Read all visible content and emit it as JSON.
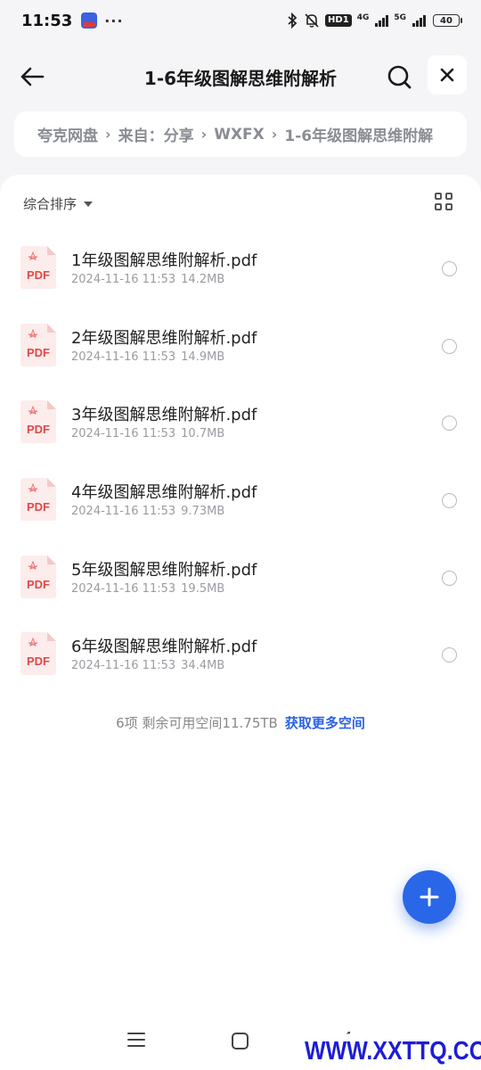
{
  "status_bar": {
    "time": "11:53",
    "dots": "···",
    "hd_label": "HD1",
    "net_4g": "4G",
    "net_5g": "5G",
    "battery": "40"
  },
  "header": {
    "title": "1-6年级图解思维附解析"
  },
  "breadcrumb": {
    "items": [
      "夸克网盘",
      "来自：分享",
      "WXFX",
      "1-6年级图解思维附解"
    ]
  },
  "toolbar": {
    "sort_label": "综合排序"
  },
  "files": [
    {
      "name": "1年级图解思维附解析.pdf",
      "date": "2024-11-16 11:53",
      "size": "14.2MB",
      "icon_label": "PDF"
    },
    {
      "name": "2年级图解思维附解析.pdf",
      "date": "2024-11-16 11:53",
      "size": "14.9MB",
      "icon_label": "PDF"
    },
    {
      "name": "3年级图解思维附解析.pdf",
      "date": "2024-11-16 11:53",
      "size": "10.7MB",
      "icon_label": "PDF"
    },
    {
      "name": "4年级图解思维附解析.pdf",
      "date": "2024-11-16 11:53",
      "size": "9.73MB",
      "icon_label": "PDF"
    },
    {
      "name": "5年级图解思维附解析.pdf",
      "date": "2024-11-16 11:53",
      "size": "19.5MB",
      "icon_label": "PDF"
    },
    {
      "name": "6年级图解思维附解析.pdf",
      "date": "2024-11-16 11:53",
      "size": "34.4MB",
      "icon_label": "PDF"
    }
  ],
  "footer": {
    "summary": "6项 剩余可用空间11.75TB",
    "link": "获取更多空间"
  },
  "watermark": "WWW.XXTTQ.COM",
  "colors": {
    "accent": "#2a66e8",
    "pdf_red": "#e04848",
    "background": "#f5f5f7"
  },
  "icons": [
    "back-arrow-icon",
    "search-icon",
    "close-icon",
    "grid-view-icon",
    "plus-icon",
    "pdf-file-icon"
  ]
}
